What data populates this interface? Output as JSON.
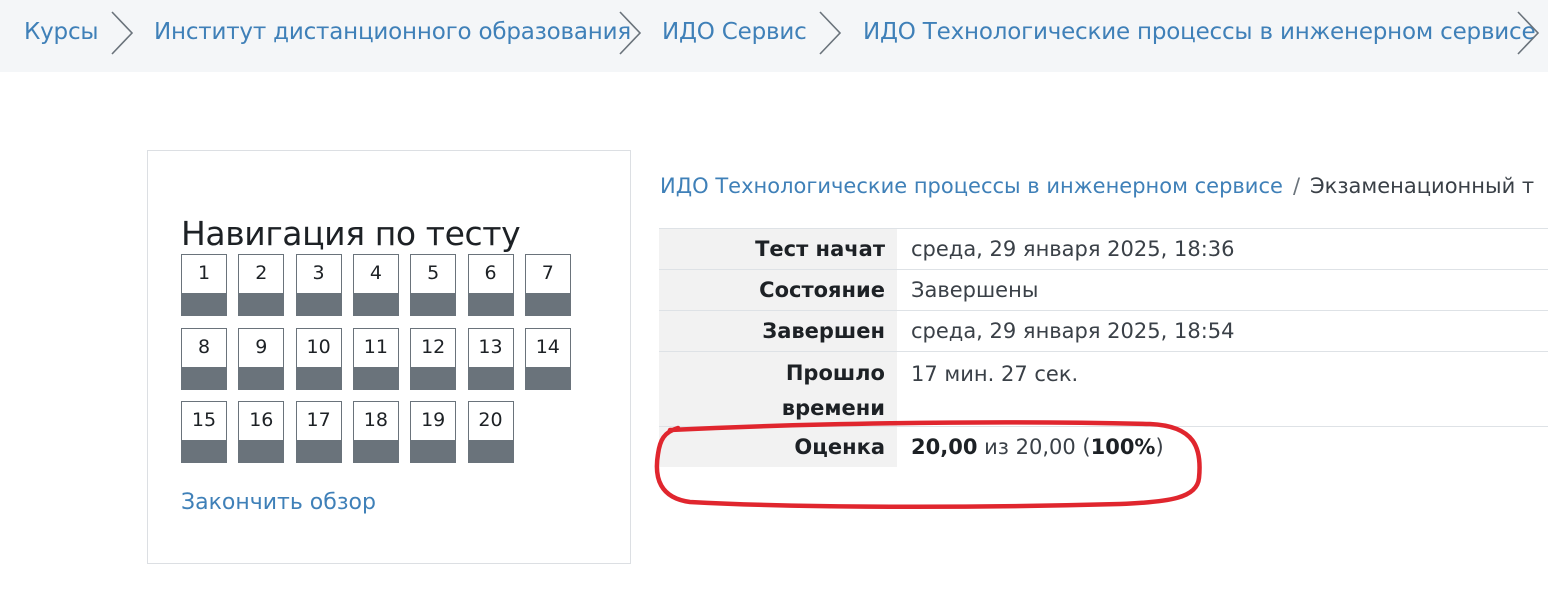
{
  "breadcrumb": {
    "items": [
      "Курсы",
      "Институт дистанционного образования",
      "ИДО Сервис",
      "ИДО Технологические процессы в инженерном сервисе"
    ]
  },
  "quiz_nav": {
    "title": "Навигация по тесту",
    "questions": [
      "1",
      "2",
      "3",
      "4",
      "5",
      "6",
      "7",
      "8",
      "9",
      "10",
      "11",
      "12",
      "13",
      "14",
      "15",
      "16",
      "17",
      "18",
      "19",
      "20"
    ],
    "finish_review": "Закончить обзор"
  },
  "main": {
    "course_link": "ИДО Технологические процессы в инженерном сервисе",
    "separator": "/",
    "quiz_name_partial": "Экзаменационный т"
  },
  "summary": {
    "started_label": "Тест начат",
    "started_value": "среда, 29 января 2025, 18:36",
    "state_label": "Состояние",
    "state_value": "Завершены",
    "completed_label": "Завершен",
    "completed_value": "среда, 29 января 2025, 18:54",
    "time_label_line1": "Прошло",
    "time_label_line2": "времени",
    "time_value": "17 мин. 27 сек.",
    "grade_label": "Оценка",
    "grade_score": "20,00",
    "grade_of": " из 20,00 (",
    "grade_percent": "100%",
    "grade_close": ")"
  },
  "colors": {
    "link": "#3f80b8",
    "nav_bar": "#6a737b",
    "highlight": "#e0262e"
  }
}
